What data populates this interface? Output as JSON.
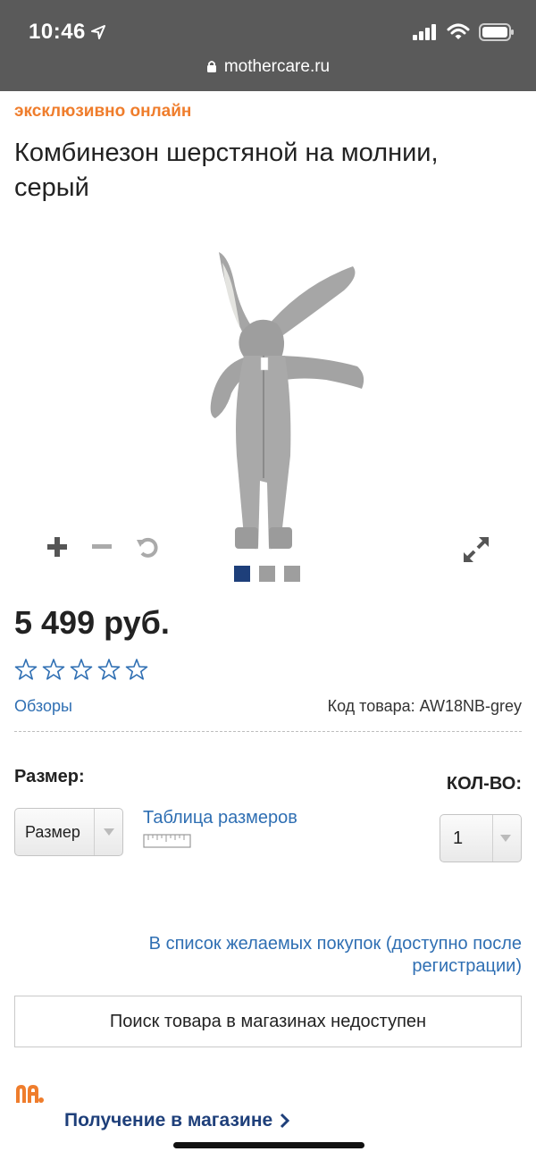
{
  "status_bar": {
    "time": "10:46",
    "url": "mothercare.ru"
  },
  "product": {
    "badge": "эксклюзивно онлайн",
    "title": "Комбинезон шерстяной на молнии, серый",
    "price": "5 499 руб.",
    "rating": {
      "stars_total": 5,
      "stars_filled": 0
    },
    "reviews_label": "Обзоры",
    "sku_label": "Код товара: AW18NB-grey",
    "gallery": {
      "image_count": 3,
      "active_index": 0
    }
  },
  "options": {
    "size_label": "Размер:",
    "size_select_value": "Размер",
    "size_table_link": "Таблица размеров",
    "qty_label": "КОЛ-ВО:",
    "qty_value": "1"
  },
  "wishlist_label": "В список желаемых покупок (доступно после регистрации)",
  "store_search_label": "Поиск товара в магазинах недоступен",
  "pickup_label": "Получение в магазине",
  "colors": {
    "accent_orange": "#ef7d2c",
    "link_blue": "#2f6fb3",
    "dark_blue": "#1e3f7a",
    "topbar_grey": "#5a5a5a"
  },
  "icons": [
    "location-arrow-icon",
    "signal-icon",
    "wifi-icon",
    "battery-icon",
    "lock-icon",
    "zoom-in-icon",
    "zoom-out-icon",
    "rotate-icon",
    "fullscreen-icon",
    "star-icon",
    "chevron-down-icon",
    "ruler-icon",
    "brand-logo-icon",
    "chevron-right-icon"
  ]
}
